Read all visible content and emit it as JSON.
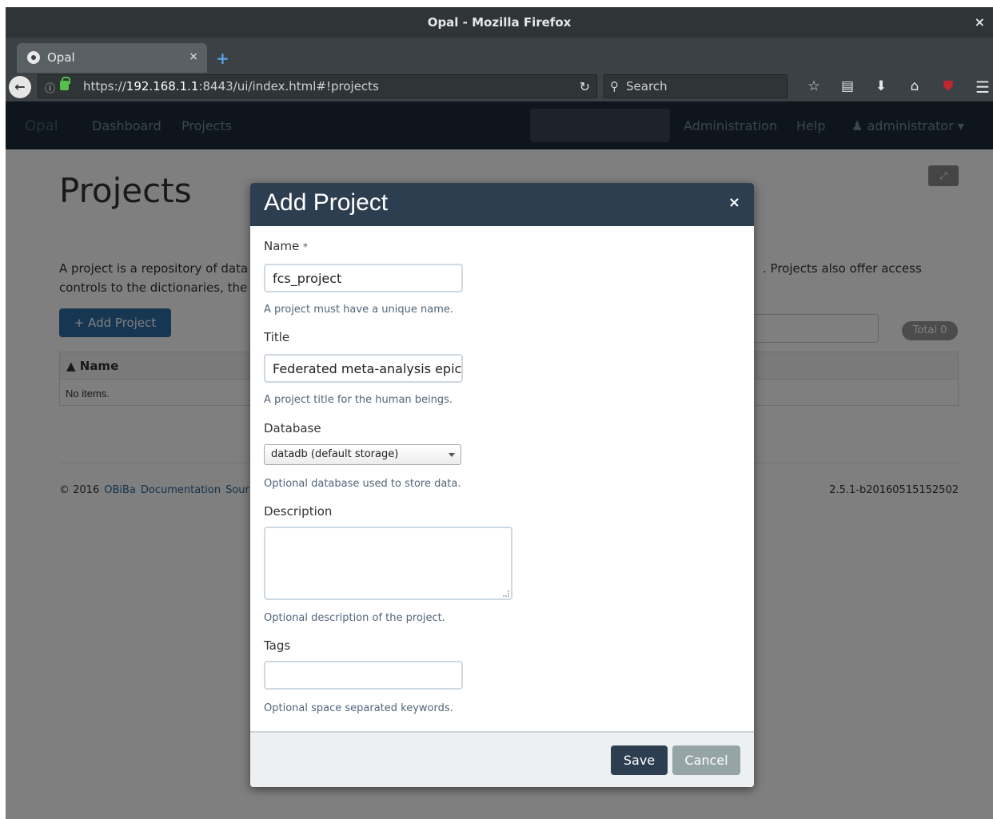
{
  "window": {
    "title": "Opal - Mozilla Firefox",
    "close": "×"
  },
  "tabs": [
    {
      "label": "Opal",
      "close": "×"
    }
  ],
  "new_tab": "+",
  "navbar": {
    "url_prefix": "https://",
    "url_host": "192.168.1.1",
    "url_rest": ":8443/ui/index.html#!projects",
    "search_placeholder": "Search"
  },
  "app_nav": {
    "brand": "Opal",
    "items": [
      "Dashboard",
      "Projects"
    ],
    "admin": "Administration",
    "help": "Help",
    "user": "administrator ▾"
  },
  "page": {
    "title": "Projects",
    "desc_left_1": "A project is a repository of data a",
    "desc_left_2": "controls to the dictionaries, the s",
    "desc_right": ". Projects also offer access",
    "add_button": "+ Add Project",
    "total_badge": "Total 0",
    "table_header": "▲ Name",
    "table_empty": "No items.",
    "footer_copy": "© 2016",
    "footer_links": [
      "OBiBa",
      "Documentation",
      "Sour"
    ],
    "version": "2.5.1-b20160515152502"
  },
  "modal": {
    "title": "Add Project",
    "close": "×",
    "name": {
      "label": "Name",
      "required": "*",
      "value": "fcs_project",
      "help": "A project must have a unique name."
    },
    "title_field": {
      "label": "Title",
      "value": "Federated meta-analysis epic",
      "help": "A project title for the human beings."
    },
    "database": {
      "label": "Database",
      "selected": "datadb (default storage)",
      "help": "Optional database used to store data."
    },
    "description": {
      "label": "Description",
      "value": "",
      "help": "Optional description of the project."
    },
    "tags": {
      "label": "Tags",
      "value": "",
      "help": "Optional space separated keywords."
    },
    "save": "Save",
    "cancel": "Cancel"
  }
}
